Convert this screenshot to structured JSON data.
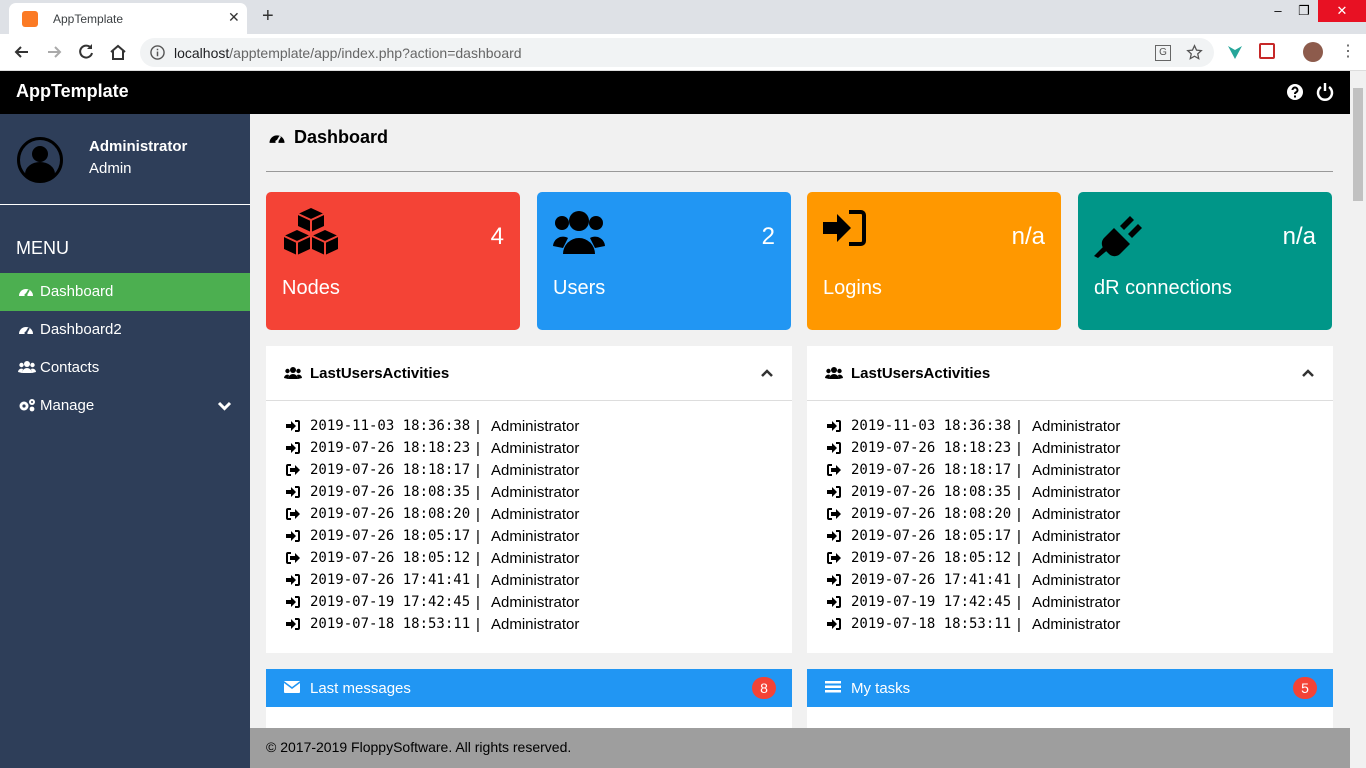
{
  "browser": {
    "tab_title": "AppTemplate",
    "url_host": "localhost",
    "url_path": "/apptemplate/app/index.php?action=dashboard"
  },
  "app": {
    "brand": "AppTemplate",
    "icons": [
      "help-icon",
      "power-icon"
    ]
  },
  "profile": {
    "name": "Administrator",
    "role": "Admin"
  },
  "sidebar": {
    "menu_header": "MENU",
    "items": [
      {
        "label": "Dashboard",
        "icon": "tachometer-icon",
        "active": true
      },
      {
        "label": "Dashboard2",
        "icon": "tachometer-icon"
      },
      {
        "label": "Contacts",
        "icon": "users-icon"
      },
      {
        "label": "Manage",
        "icon": "cogs-icon"
      }
    ]
  },
  "page": {
    "title": "Dashboard"
  },
  "stats": [
    {
      "label": "Nodes",
      "value": "4",
      "color": "#f44336",
      "icon": "cubes-icon"
    },
    {
      "label": "Users",
      "value": "2",
      "color": "#2196f3",
      "icon": "users-icon"
    },
    {
      "label": "Logins",
      "value": "n/a",
      "color": "#ff9800",
      "icon": "sign-in-icon"
    },
    {
      "label": "dR connections",
      "value": "n/a",
      "color": "#009688",
      "icon": "plug-icon"
    }
  ],
  "activity_panels": [
    {
      "title": "LastUsersActivities"
    },
    {
      "title": "LastUsersActivities"
    }
  ],
  "activities": [
    {
      "type": "login",
      "datetime": "2019-11-03 18:36:38",
      "sep": "|",
      "user": "Administrator"
    },
    {
      "type": "login",
      "datetime": "2019-07-26 18:18:23",
      "sep": "|",
      "user": "Administrator"
    },
    {
      "type": "logout",
      "datetime": "2019-07-26 18:18:17",
      "sep": "|",
      "user": "Administrator"
    },
    {
      "type": "login",
      "datetime": "2019-07-26 18:08:35",
      "sep": "|",
      "user": "Administrator"
    },
    {
      "type": "logout",
      "datetime": "2019-07-26 18:08:20",
      "sep": "|",
      "user": "Administrator"
    },
    {
      "type": "login",
      "datetime": "2019-07-26 18:05:17",
      "sep": "|",
      "user": "Administrator"
    },
    {
      "type": "logout",
      "datetime": "2019-07-26 18:05:12",
      "sep": "|",
      "user": "Administrator"
    },
    {
      "type": "login",
      "datetime": "2019-07-26 17:41:41",
      "sep": "|",
      "user": "Administrator"
    },
    {
      "type": "login",
      "datetime": "2019-07-19 17:42:45",
      "sep": "|",
      "user": "Administrator"
    },
    {
      "type": "login",
      "datetime": "2019-07-18 18:53:11",
      "sep": "|",
      "user": "Administrator"
    }
  ],
  "bottom_panels": [
    {
      "title": "Last messages",
      "badge": "8",
      "icon": "envelope-icon"
    },
    {
      "title": "My tasks",
      "badge": "5",
      "icon": "tasks-icon"
    }
  ],
  "footer": {
    "text": "© 2017-2019 FloppySoftware. All rights reserved."
  }
}
